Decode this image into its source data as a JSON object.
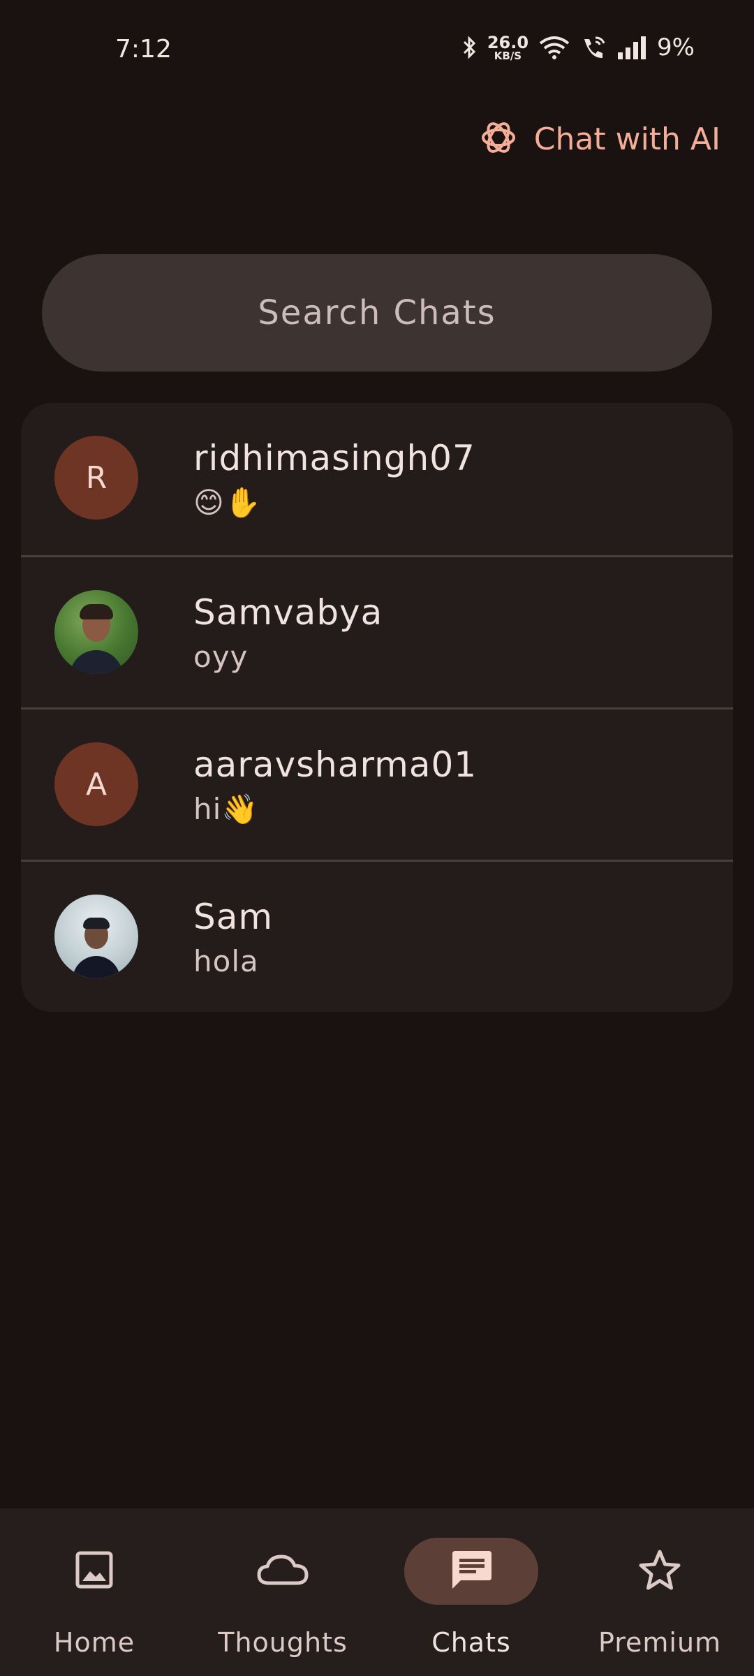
{
  "status_bar": {
    "time": "7:12",
    "net_speed_value": "26.0",
    "net_speed_unit": "KB/S",
    "battery": "9%"
  },
  "header": {
    "ai_button_label": "Chat with AI",
    "ai_icon": "openai-logo-icon"
  },
  "search": {
    "placeholder": "Search Chats"
  },
  "chats": [
    {
      "avatar_letter": "R",
      "name": "ridhimasingh07",
      "last_message": "😊✋"
    },
    {
      "avatar_letter": "",
      "name": "Samvabya",
      "last_message": "oyy"
    },
    {
      "avatar_letter": "A",
      "name": "aaravsharma01",
      "last_message": "hi👋"
    },
    {
      "avatar_letter": "",
      "name": "Sam",
      "last_message": "hola"
    }
  ],
  "bottom_nav": {
    "items": [
      {
        "label": "Home",
        "icon": "image-icon"
      },
      {
        "label": "Thoughts",
        "icon": "cloud-icon"
      },
      {
        "label": "Chats",
        "icon": "chat-icon"
      },
      {
        "label": "Premium",
        "icon": "star-icon"
      }
    ],
    "active": "Chats"
  },
  "colors": {
    "background": "#1a1211",
    "accent": "#f4ad98",
    "avatar_letter_bg": "#6e3525",
    "active_nav_pill": "#5c3f37"
  }
}
